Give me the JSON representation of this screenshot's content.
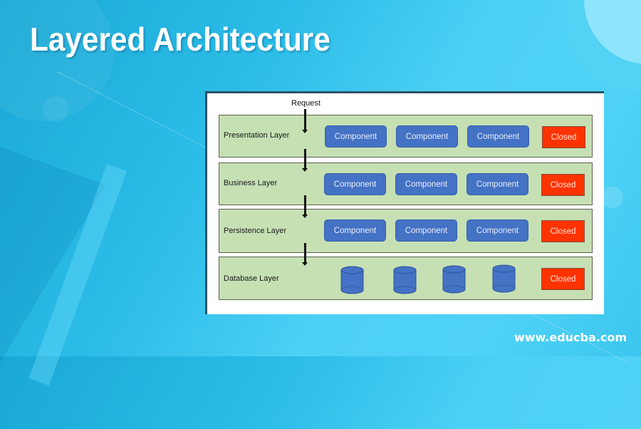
{
  "title": "Layered Architecture",
  "footer": {
    "url": "www.educba.com"
  },
  "diagram": {
    "request_label": "Request",
    "colors": {
      "layer_fill": "#c6e0b4",
      "component_fill": "#4472c4",
      "closed_fill": "#ff3300"
    },
    "layers": [
      {
        "label": "Presentation Layer",
        "components": [
          "Component",
          "Component",
          "Component"
        ],
        "closed_label": "Closed"
      },
      {
        "label": "Business Layer",
        "components": [
          "Component",
          "Component",
          "Component"
        ],
        "closed_label": "Closed"
      },
      {
        "label": "Persistence Layer",
        "components": [
          "Component",
          "Component",
          "Component"
        ],
        "closed_label": "Closed"
      },
      {
        "label": "Database Layer",
        "databases": [
          "database",
          "database",
          "database",
          "database"
        ],
        "closed_label": "Closed"
      }
    ]
  }
}
